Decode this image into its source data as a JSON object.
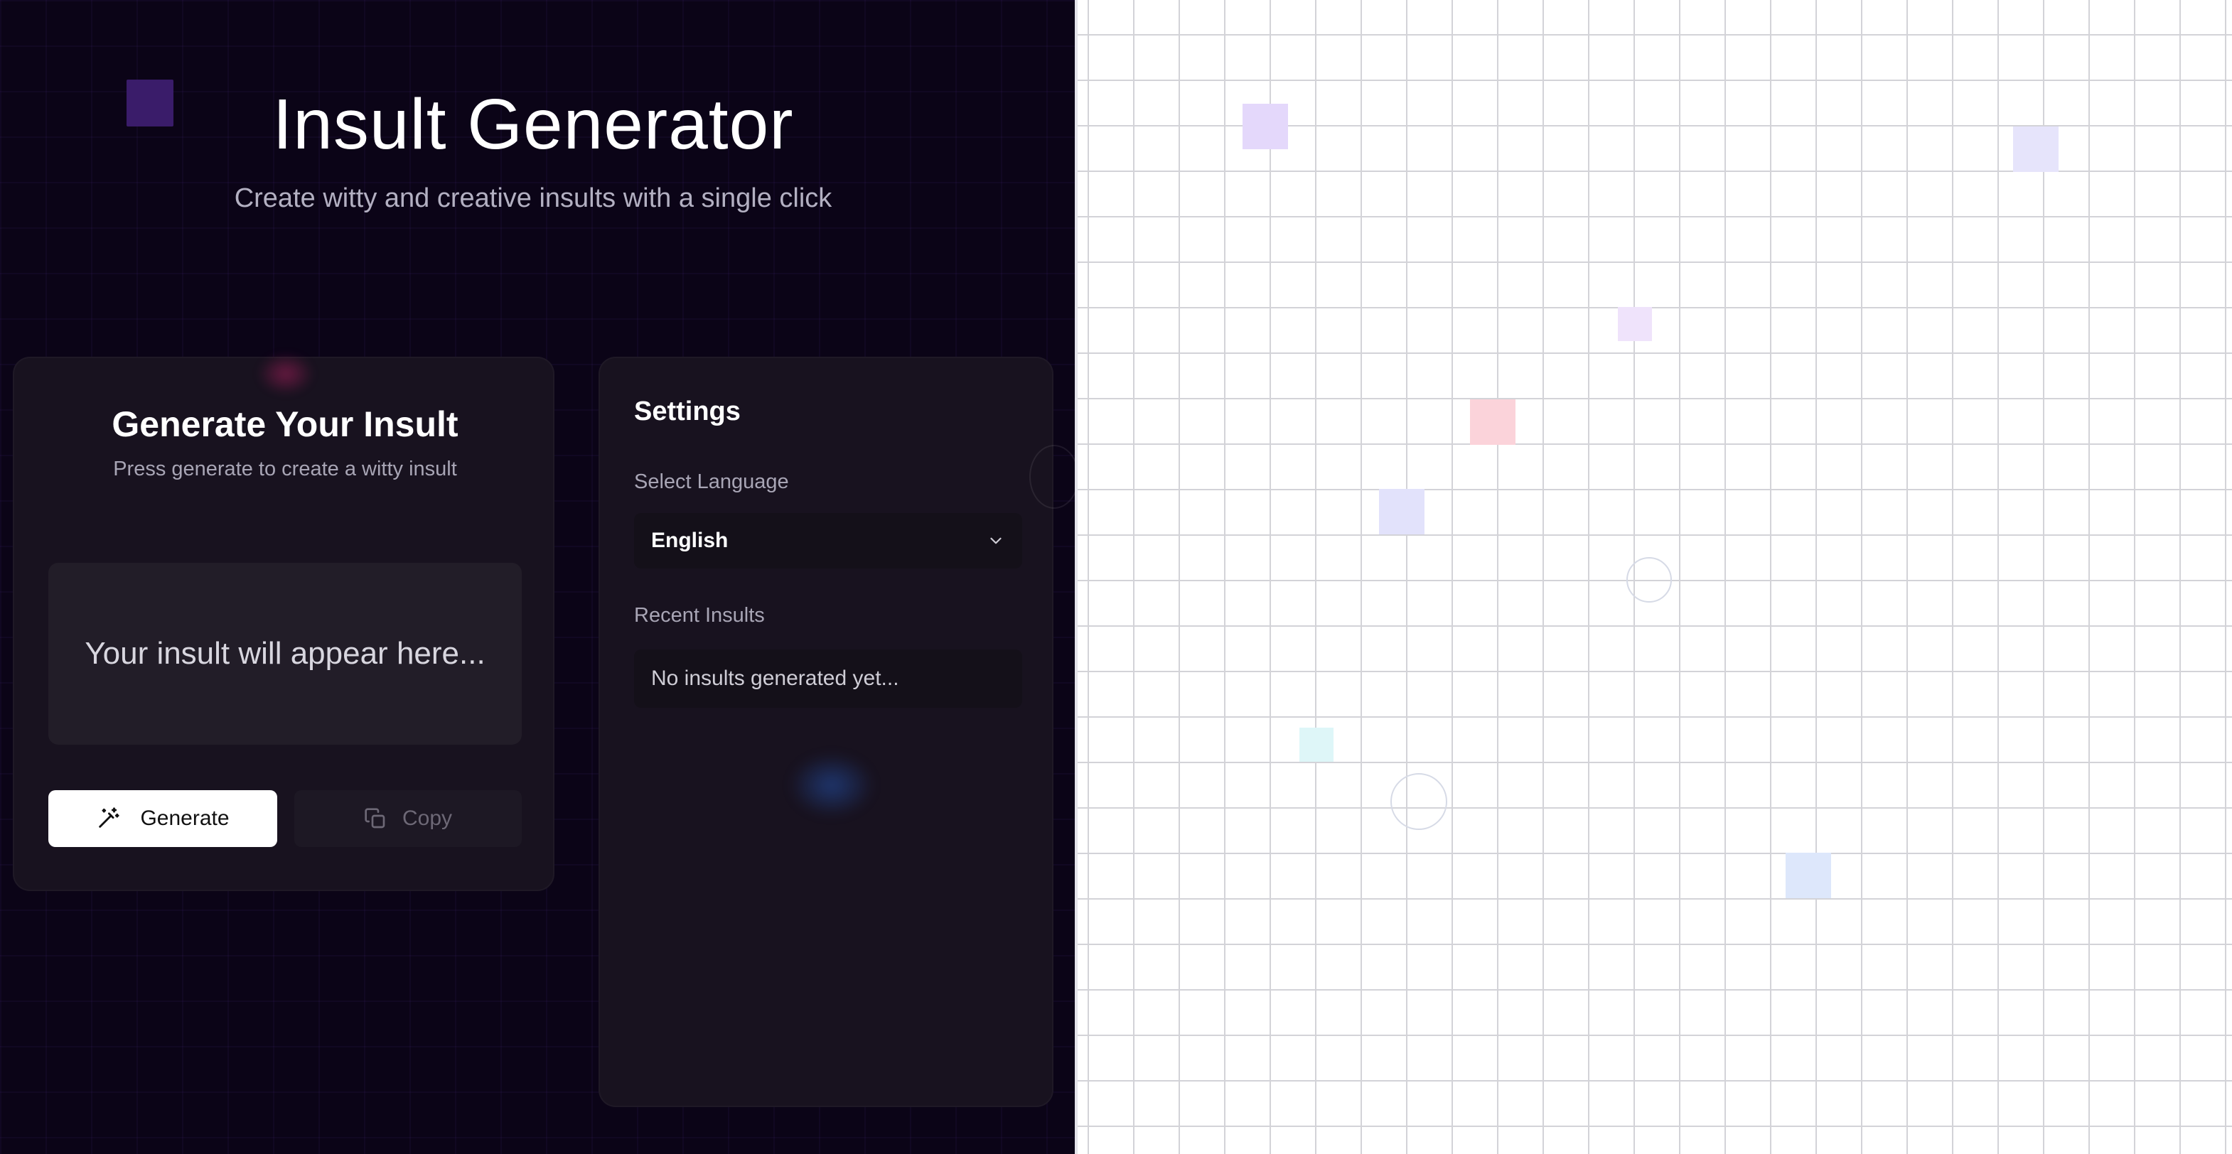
{
  "app": {
    "title": "Insult Generator",
    "subtitle": "Create witty and creative insults with a single click"
  },
  "generator": {
    "title": "Generate Your Insult",
    "subtitle": "Press generate to create a witty insult",
    "placeholder": "Your insult will appear here...",
    "generate_label": "Generate",
    "generate_icon": "magic-wand-icon",
    "copy_label": "Copy",
    "copy_icon": "copy-icon"
  },
  "settings": {
    "title": "Settings",
    "language_label": "Select Language",
    "language_value": "English",
    "recent_label": "Recent Insults",
    "recent_empty": "No insults generated yet..."
  },
  "colors": {
    "dark_bg": "#0b0417",
    "card_bg": "#18121f",
    "accent_purple": "#3a1c6a",
    "button_bg": "#ffffff"
  }
}
